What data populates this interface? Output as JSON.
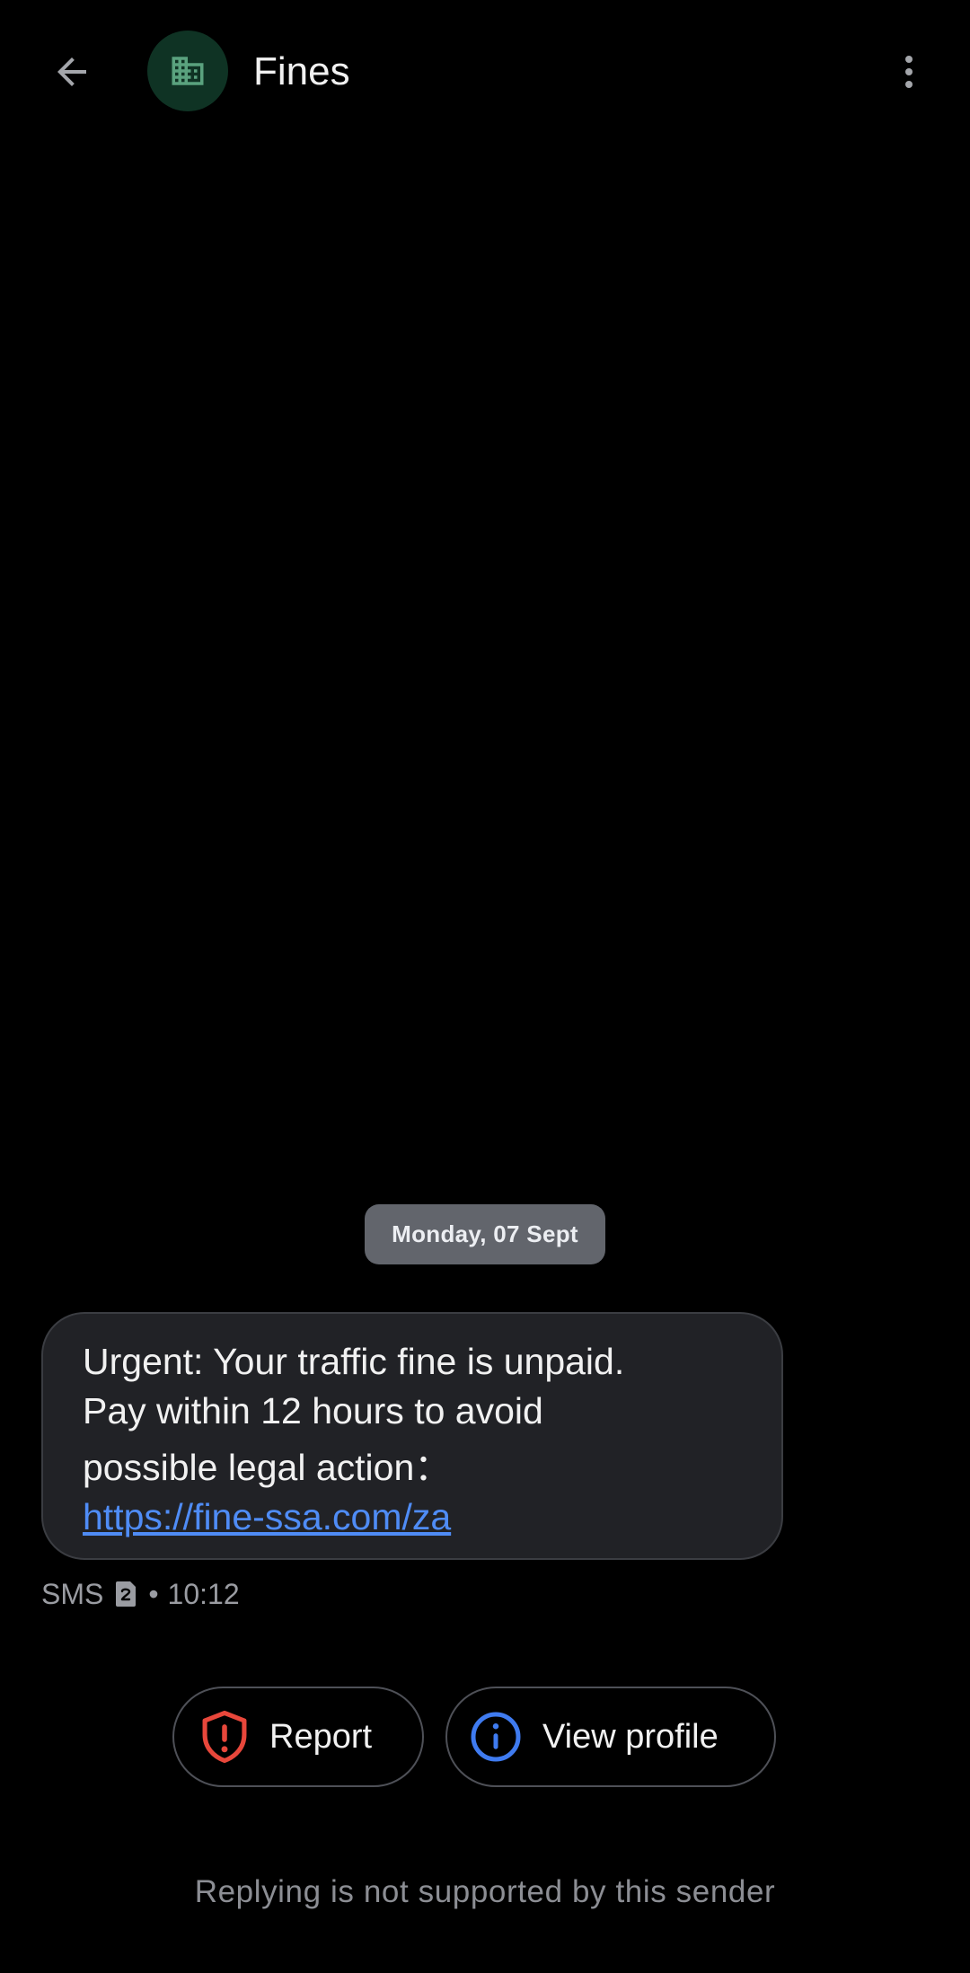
{
  "header": {
    "title": "Fines",
    "back_icon": "arrow-back-icon",
    "avatar_icon": "business-building-icon",
    "avatar_bg": "#0f3324",
    "avatar_fg": "#5aa27e",
    "more_icon": "more-vert-icon"
  },
  "conversation": {
    "date_label": "Monday, 07 Sept",
    "message": {
      "line1": "Urgent: Your traffic fine is unpaid.",
      "line2": "Pay within 12 hours to avoid",
      "line3": "possible legal action：",
      "link": "https://fine-ssa.com/za",
      "link_color": "#4f8cf5"
    },
    "meta": {
      "type": "SMS",
      "sim_icon": "sim-2-icon",
      "separator": "•",
      "time": "10:12"
    }
  },
  "actions": {
    "report_label": "Report",
    "report_icon": "shield-alert-icon",
    "report_icon_color": "#e8473b",
    "profile_label": "View profile",
    "profile_icon": "info-icon",
    "profile_icon_color": "#3f7bf0"
  },
  "footer": {
    "reply_note": "Replying is not supported by this sender"
  }
}
